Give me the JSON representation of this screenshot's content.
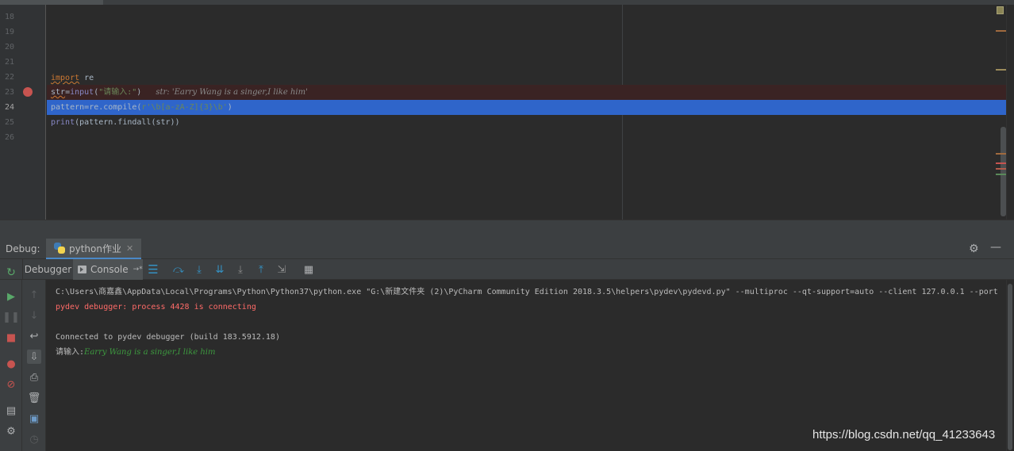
{
  "editor": {
    "line_numbers": [
      "18",
      "19",
      "20",
      "21",
      "22",
      "23",
      "24",
      "25",
      "26"
    ],
    "current_line": "24",
    "code": {
      "l22": {
        "kw": "import",
        "rest": " re"
      },
      "l23": {
        "var": "str",
        "eq": "=",
        "fn": "input",
        "open": "(",
        "str": "\"请输入:\"",
        "close": ")",
        "inline": "str: 'Earry Wang is a singer,I like him'"
      },
      "l24": {
        "var": "pattern",
        "eq": "=",
        "call": "re.compile(",
        "str": "r'\\b[a-zA-Z]{3}\\b'",
        "close": ")"
      },
      "l25": {
        "fn": "print",
        "rest": "(pattern.findall(str))"
      }
    }
  },
  "debug": {
    "title": "Debug:",
    "run_tab_label": "python作业",
    "tab_debugger": "Debugger",
    "tab_console": "Console",
    "console_pin": "→*"
  },
  "console": {
    "line1": "C:\\Users\\商嘉鑫\\AppData\\Local\\Programs\\Python\\Python37\\python.exe \"G:\\新建文件夹 (2)\\PyCharm Community Edition 2018.3.5\\helpers\\pydev\\pydevd.py\" --multiproc --qt-support=auto --client 127.0.0.1 --port",
    "line2": "pydev debugger: process 4428 is connecting",
    "line3": "Connected to pydev debugger (build 183.5912.18)",
    "prompt": "请输入:",
    "user_input": "Earry Wang is a singer,I like him"
  },
  "icons": {
    "rerun": "rerun-icon",
    "resume": "resume-icon",
    "pause": "pause-icon",
    "stop": "stop-icon",
    "view_breakpoints": "view-breakpoints-icon",
    "mute_breakpoints": "mute-breakpoints-icon",
    "settings": "gear-icon"
  },
  "colors": {
    "accent": "#2f65ca",
    "breakpoint": "#c75450",
    "keyword": "#cc7832",
    "string": "#6a8759",
    "error": "#ff6b68",
    "user_input": "#3d9a3f"
  },
  "watermark": "https://blog.csdn.net/qq_41233643"
}
